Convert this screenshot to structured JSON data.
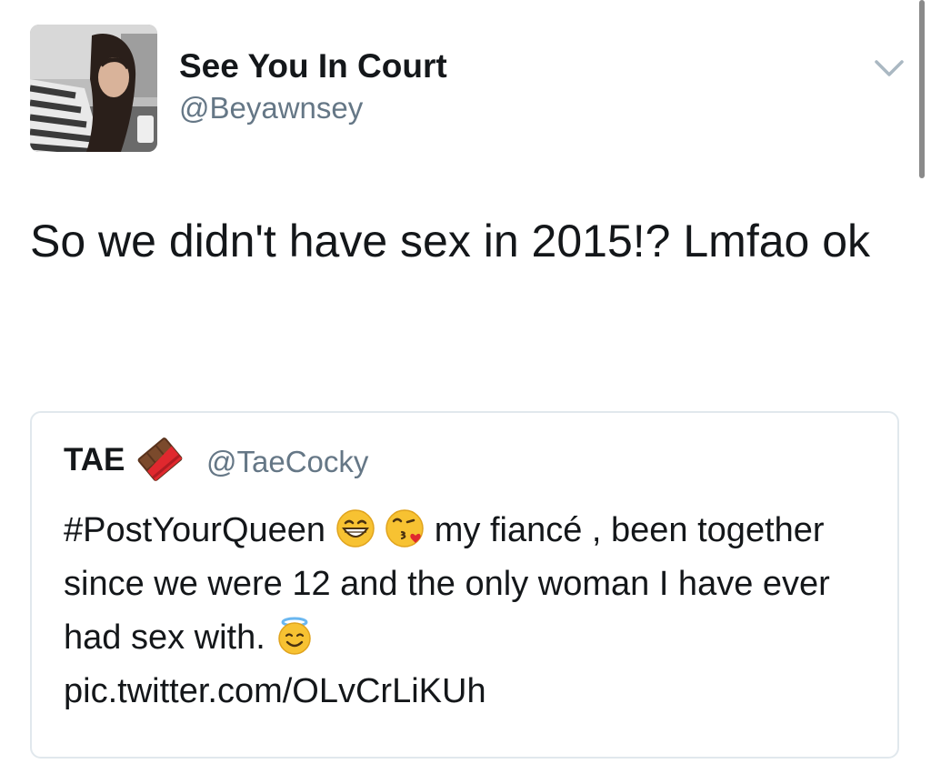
{
  "tweet": {
    "display_name": "See You In Court",
    "handle": "@Beyawnsey",
    "text": "So we didn't have sex in 2015!? Lmfao ok",
    "menu_icon": "chevron-down-icon",
    "avatar_icon": "profile-photo"
  },
  "quoted_tweet": {
    "display_name": "TAE",
    "name_emoji": "chocolate-bar-icon",
    "handle": "@TaeCocky",
    "hashtag": "#PostYourQueen",
    "emoji_1": "grinning-face-icon",
    "emoji_2": "face-blowing-kiss-icon",
    "text_part_1": "my fiancé , been together since we were 12 and the only woman I have ever had sex with.",
    "emoji_3": "smiling-face-with-halo-icon",
    "link": "pic.twitter.com/OLvCrLiKUh"
  },
  "colors": {
    "text": "#14171a",
    "secondary": "#657786",
    "border": "#e1e8ed",
    "chevron": "#aab8c2"
  }
}
